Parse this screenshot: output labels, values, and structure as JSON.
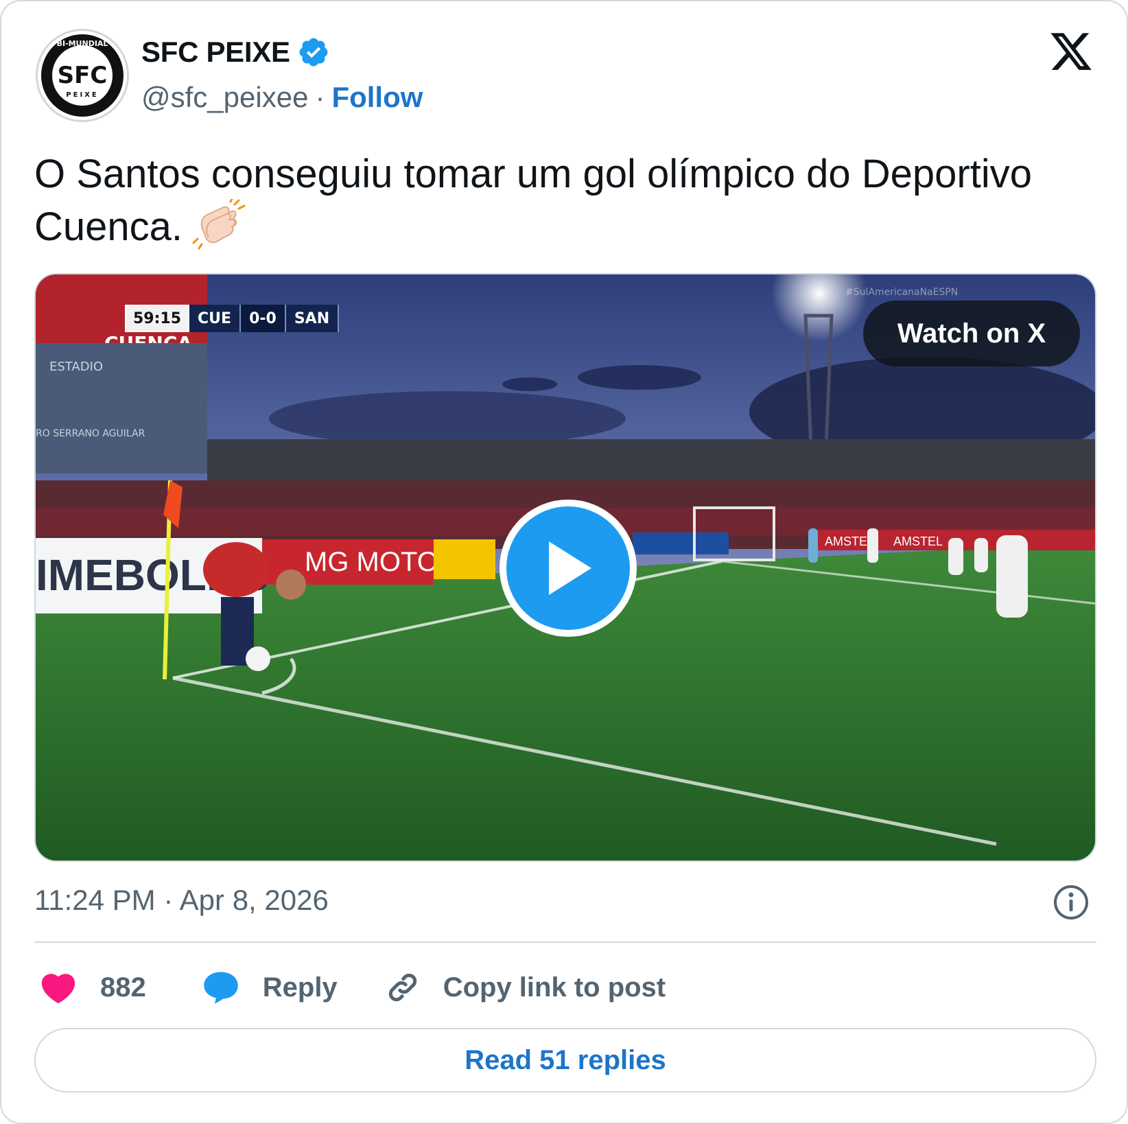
{
  "author": {
    "display_name": "SFC PEIXE",
    "handle": "@sfc_peixee",
    "verified": true,
    "avatar_text": "SFC",
    "avatar_ring_top": "BI-MUNDIAL",
    "avatar_ring_bottom": "PEIXE"
  },
  "header": {
    "separator": "·",
    "follow_label": "Follow",
    "logo_icon": "x-logo-icon"
  },
  "tweet": {
    "text": "O Santos conseguiu tomar um gol olímpico do Deportivo Cuenca.",
    "emoji_icon": "clapping-hands-icon"
  },
  "media": {
    "watch_label": "Watch on X",
    "scorebug": {
      "time": "59:15",
      "home": "CUE",
      "score": "0-0",
      "away": "SAN"
    },
    "board_texts": [
      "IMEBOL.co",
      "MG MOTOR",
      "AMSTEL",
      "AMSTEL"
    ],
    "stand_texts": [
      "CUENCA",
      "ESTADIO",
      "RO SERRANO AGUILAR"
    ],
    "watermark": "#SulAmericanaNaESPN"
  },
  "meta": {
    "timestamp": "11:24 PM · Apr 8, 2026"
  },
  "actions": {
    "like_count": "882",
    "reply_label": "Reply",
    "copy_label": "Copy link to post"
  },
  "footer": {
    "read_replies_label": "Read 51 replies"
  },
  "colors": {
    "link_blue": "#1d75c9",
    "play_blue": "#1d9bf0",
    "heart_pink": "#f91880",
    "muted_gray": "#536471",
    "border_gray": "#cfd9de"
  }
}
